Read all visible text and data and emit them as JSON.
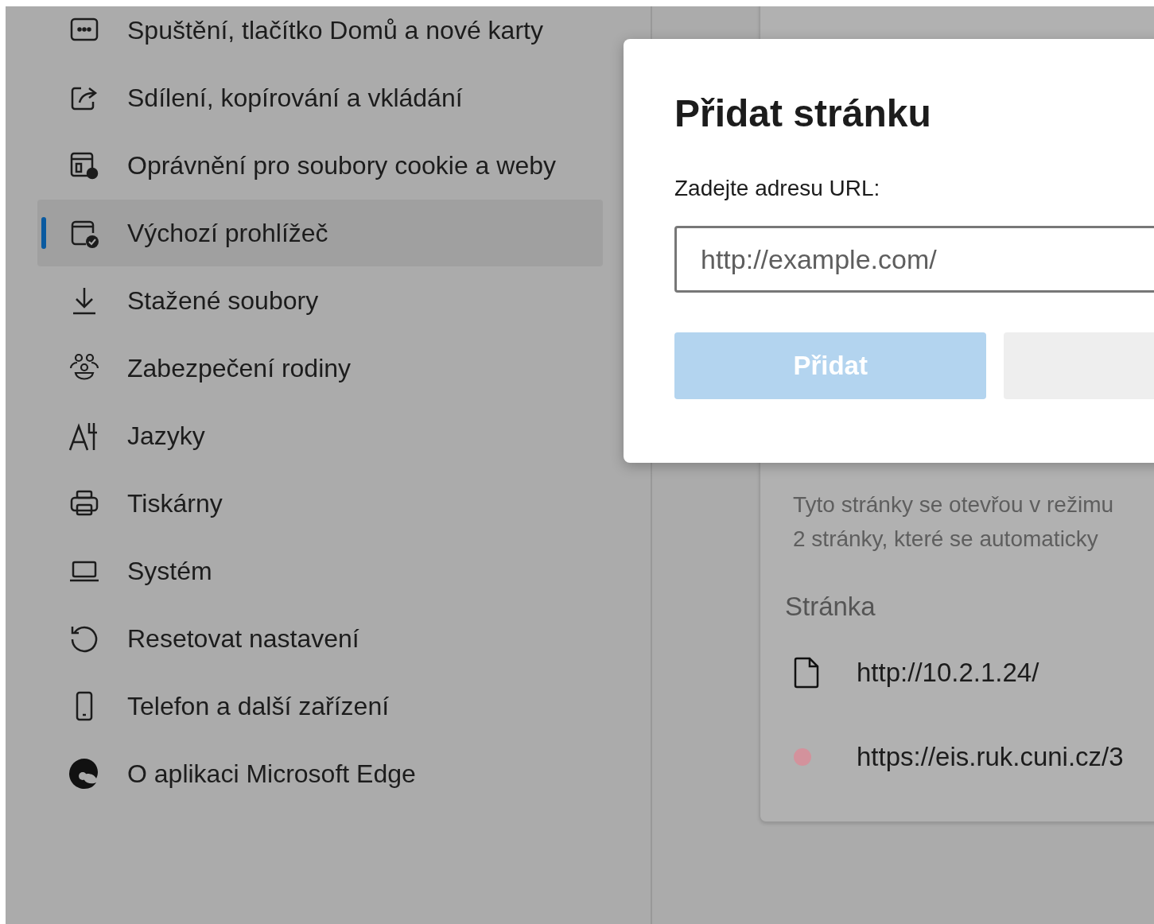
{
  "sidebar": {
    "items": [
      {
        "label": "Spuštění, tlačítko Domů a nové karty",
        "selected": false
      },
      {
        "label": "Sdílení, kopírování a vkládání",
        "selected": false
      },
      {
        "label": "Oprávnění pro soubory cookie a weby",
        "selected": false
      },
      {
        "label": "Výchozí prohlížeč",
        "selected": true
      },
      {
        "label": "Stažené soubory",
        "selected": false
      },
      {
        "label": "Zabezpečení rodiny",
        "selected": false
      },
      {
        "label": "Jazyky",
        "selected": false
      },
      {
        "label": "Tiskárny",
        "selected": false
      },
      {
        "label": "Systém",
        "selected": false
      },
      {
        "label": "Resetovat nastavení",
        "selected": false
      },
      {
        "label": "Telefon a další zařízení",
        "selected": false
      },
      {
        "label": "O aplikaci Microsoft Edge",
        "selected": false
      }
    ]
  },
  "ie_pages": {
    "description_lines": [
      "Tyto stránky se otevřou v režimu",
      "2 stránky, které se automaticky"
    ],
    "column_header": "Stránka",
    "rows": [
      {
        "kind": "file",
        "url": "http://10.2.1.24/"
      },
      {
        "kind": "favicon",
        "url": "https://eis.ruk.cuni.cz/3"
      }
    ]
  },
  "dialog": {
    "title": "Přidat stránku",
    "label": "Zadejte adresu URL:",
    "placeholder": "http://example.com/",
    "buttons": [
      {
        "kind": "primary",
        "label": "Přidat",
        "disabled": true
      },
      {
        "kind": "secondary"
      }
    ]
  }
}
